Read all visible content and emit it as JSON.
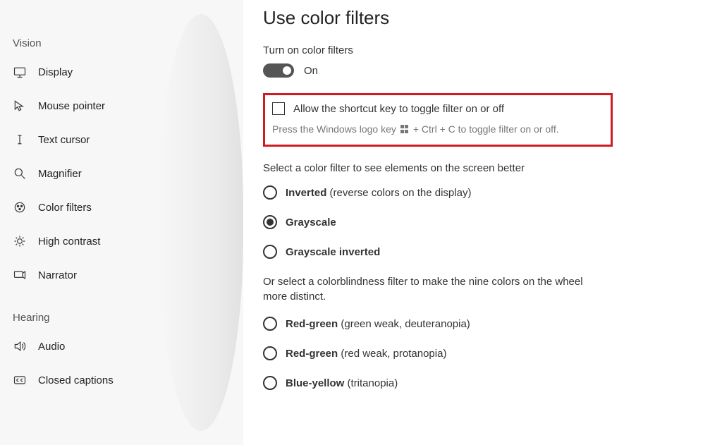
{
  "sidebar": {
    "sections": {
      "vision": {
        "title": "Vision",
        "items": [
          {
            "label": "Display"
          },
          {
            "label": "Mouse pointer"
          },
          {
            "label": "Text cursor"
          },
          {
            "label": "Magnifier"
          },
          {
            "label": "Color filters"
          },
          {
            "label": "High contrast"
          },
          {
            "label": "Narrator"
          }
        ]
      },
      "hearing": {
        "title": "Hearing",
        "items": [
          {
            "label": "Audio"
          },
          {
            "label": "Closed captions"
          }
        ]
      }
    }
  },
  "main": {
    "title": "Use color filters",
    "toggle_section": {
      "label": "Turn on color filters",
      "state_label": "On",
      "state": true
    },
    "shortcut": {
      "checkbox_label": "Allow the shortcut key to toggle filter on or off",
      "hint_pre": "Press the Windows logo key",
      "hint_post": "+ Ctrl + C to toggle filter on or off.",
      "checked": false
    },
    "filter_section": {
      "heading": "Select a color filter to see elements on the screen better",
      "options": [
        {
          "label_bold": "Inverted",
          "label_extra": " (reverse colors on the display)",
          "selected": false
        },
        {
          "label_bold": "Grayscale",
          "label_extra": "",
          "selected": true
        },
        {
          "label_bold": "Grayscale inverted",
          "label_extra": "",
          "selected": false
        }
      ]
    },
    "colorblind_section": {
      "heading": "Or select a colorblindness filter to make the nine colors on the wheel more distinct.",
      "options": [
        {
          "label_bold": "Red-green",
          "label_extra": " (green weak, deuteranopia)",
          "selected": false
        },
        {
          "label_bold": "Red-green",
          "label_extra": " (red weak, protanopia)",
          "selected": false
        },
        {
          "label_bold": "Blue-yellow",
          "label_extra": " (tritanopia)",
          "selected": false
        }
      ]
    }
  }
}
